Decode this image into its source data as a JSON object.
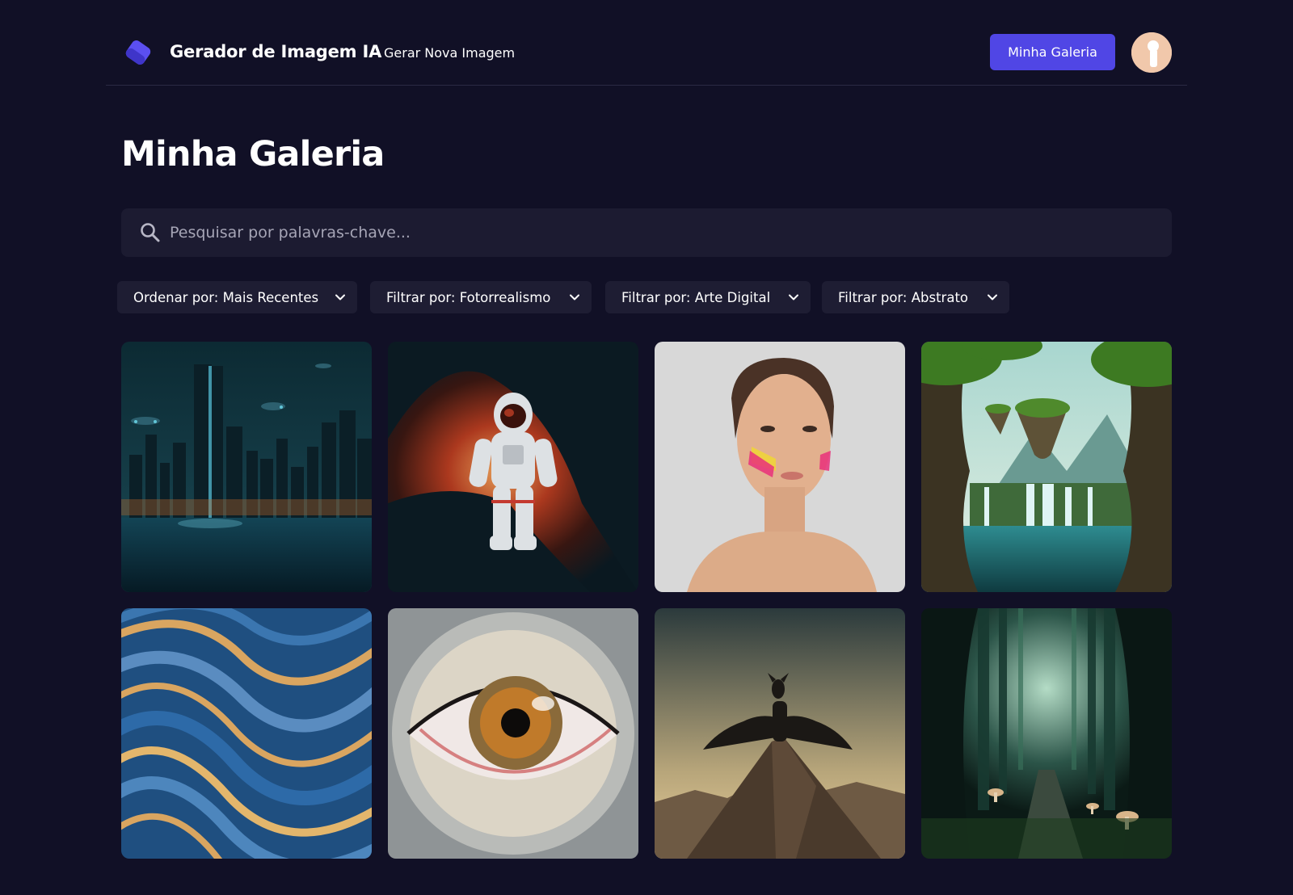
{
  "header": {
    "app_title": "Gerador de Imagem IA",
    "nav_link": "Gerar Nova Imagem",
    "gallery_button": "Minha Galeria",
    "accent_color": "#5046e5"
  },
  "page": {
    "title": "Minha Galeria"
  },
  "search": {
    "placeholder": "Pesquisar por palavras-chave...",
    "value": ""
  },
  "filters": [
    {
      "label": "Ordenar por: Mais Recentes"
    },
    {
      "label": "Filtrar por: Fotorrealismo"
    },
    {
      "label": "Filtrar por: Arte Digital"
    },
    {
      "label": "Filtrar por: Abstrato"
    }
  ],
  "gallery": [
    {
      "subject": "futuristic-city-at-night"
    },
    {
      "subject": "astronaut-in-nebula"
    },
    {
      "subject": "woman-portrait-face-paint"
    },
    {
      "subject": "floating-islands-waterfall"
    },
    {
      "subject": "abstract-blue-gold-waves"
    },
    {
      "subject": "mechanical-eye-closeup"
    },
    {
      "subject": "dragon-on-mountain-peak"
    },
    {
      "subject": "misty-forest-path-mushrooms"
    }
  ],
  "icons": {
    "logo": "logo-icon",
    "search": "search-icon",
    "dropdown": "chevron-down-icon"
  }
}
